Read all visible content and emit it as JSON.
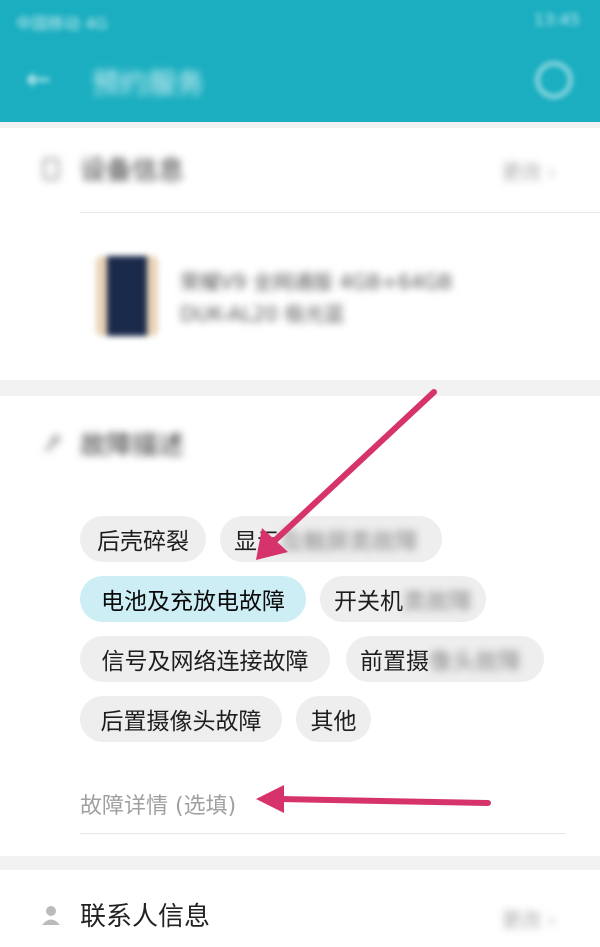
{
  "status_bar": {
    "left_text": "中国移动 4G",
    "right_text": "13:45"
  },
  "app_bar": {
    "title": "预约服务"
  },
  "device_section": {
    "title": "设备信息",
    "more_label": "更改",
    "device_name_line1": "荣耀V9 全网通版 4GB+64GB",
    "device_name_line2": "DUK-AL20 极光蓝"
  },
  "fault_section": {
    "title": "故障描述",
    "chips": [
      {
        "label": "后壳碎裂",
        "selected": false
      },
      {
        "label_visible": "显示",
        "label_blurred": "及触屏类故障",
        "selected": false
      },
      {
        "label": "电池及充放电故障",
        "selected": true
      },
      {
        "label_visible": "开关机",
        "label_blurred": "类故障",
        "selected": false
      },
      {
        "label": "信号及网络连接故障",
        "selected": false
      },
      {
        "label_visible": "前置摄",
        "label_blurred": "像头故障",
        "selected": false
      },
      {
        "label": "后置摄像头故障",
        "selected": false
      },
      {
        "label": "其他",
        "selected": false
      }
    ],
    "detail_placeholder": "故障详情 (选填)"
  },
  "contact_section": {
    "title": "联系人信息",
    "more_label": "更改"
  },
  "colors": {
    "accent": "#1aaec0",
    "selected_chip": "#cdeef5",
    "arrow": "#d6336c"
  },
  "icons": [
    "back-arrow-icon",
    "help-icon",
    "phone-icon",
    "wrench-icon",
    "person-icon",
    "chevron-right-icon"
  ]
}
